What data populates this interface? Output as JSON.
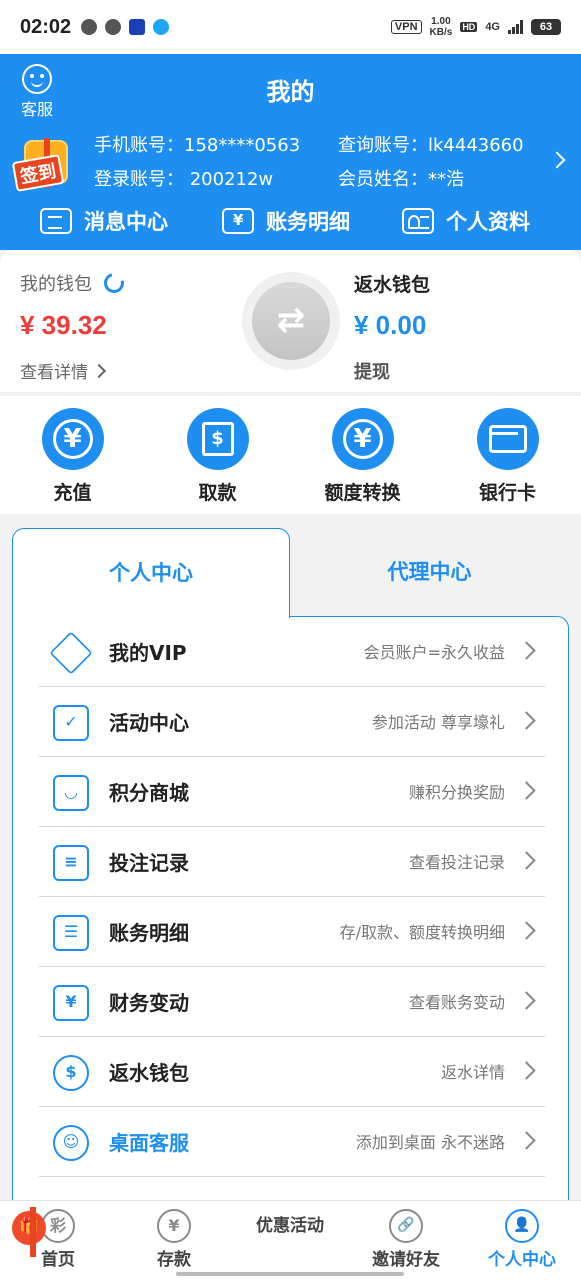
{
  "status_bar": {
    "time": "02:02",
    "vpn": "VPN",
    "speed_top": "1.00",
    "speed_bottom": "KB/s",
    "hd": "HD",
    "network": "4G",
    "battery": "63"
  },
  "header": {
    "customer_service": "客服",
    "title": "我的",
    "signin_badge": "签到",
    "phone_label": "手机账号：158****0563",
    "login_label": "登录账号：  200212w",
    "query_label": "查询账号：lk4443660",
    "member_label": "会员姓名：**浩",
    "quick_links": [
      "消息中心",
      "账务明细",
      "个人资料"
    ]
  },
  "wallet": {
    "my_wallet_label": "我的钱包",
    "my_wallet_amount": "¥ 39.32",
    "view_details": "查看详情",
    "rebate_label": "返水钱包",
    "rebate_amount": "¥ 0.00",
    "withdraw": "提现",
    "swap_symbol": "⇄"
  },
  "actions": [
    {
      "label": "充值",
      "icon": "recharge-yen-icon"
    },
    {
      "label": "取款",
      "icon": "atm-withdraw-icon"
    },
    {
      "label": "额度转换",
      "icon": "quota-transfer-icon"
    },
    {
      "label": "银行卡",
      "icon": "bank-card-icon"
    }
  ],
  "tabs": {
    "personal": "个人中心",
    "agent": "代理中心"
  },
  "menu": [
    {
      "title": "我的VIP",
      "subtitle": "会员账户=永久收益",
      "icon": "vip-diamond-icon"
    },
    {
      "title": "活动中心",
      "subtitle": "参加活动 尊享壕礼",
      "icon": "clipboard-check-icon"
    },
    {
      "title": "积分商城",
      "subtitle": "赚积分换奖励",
      "icon": "shopping-bag-icon"
    },
    {
      "title": "投注记录",
      "subtitle": "查看投注记录",
      "icon": "bet-record-icon"
    },
    {
      "title": "账务明细",
      "subtitle": "存/取款、额度转换明细",
      "icon": "ledger-list-icon"
    },
    {
      "title": "财务变动",
      "subtitle": "查看账务变动",
      "icon": "finance-change-icon"
    },
    {
      "title": "返水钱包",
      "subtitle": "返水详情",
      "icon": "rebate-wallet-icon"
    },
    {
      "title": "桌面客服",
      "subtitle": "添加到桌面 永不迷路",
      "icon": "headset-icon"
    }
  ],
  "bottom_nav": [
    {
      "label": "首页",
      "glyph": "彩"
    },
    {
      "label": "存款",
      "glyph": "¥"
    },
    {
      "label": "优惠活动",
      "glyph": "🎁"
    },
    {
      "label": "邀请好友",
      "glyph": "🔗"
    },
    {
      "label": "个人中心",
      "glyph": "👤"
    }
  ],
  "colors": {
    "brand_blue": "#1e8ff0",
    "amount_red": "#ee3b3b"
  }
}
